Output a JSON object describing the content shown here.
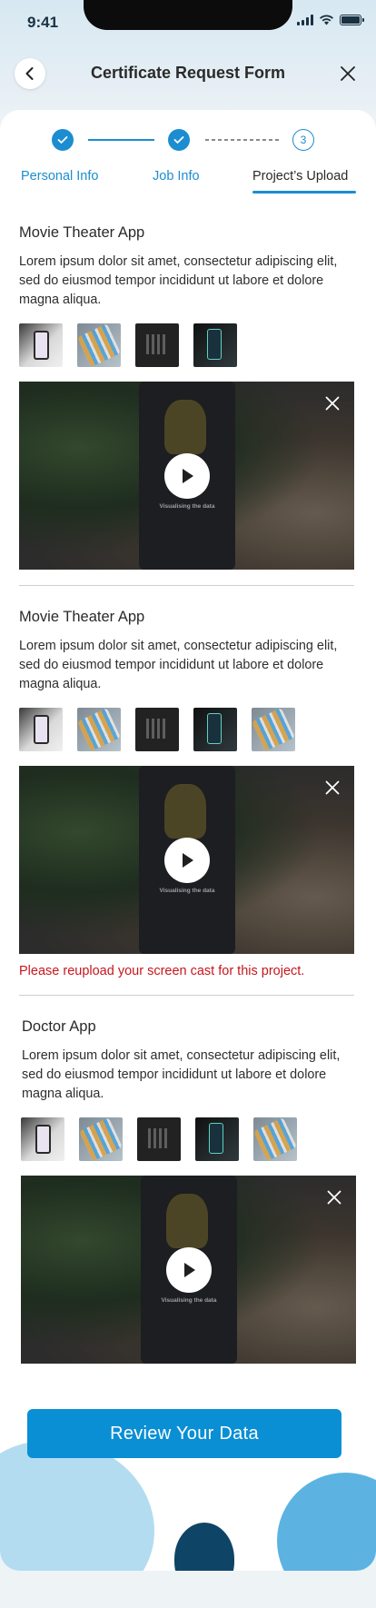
{
  "status_bar": {
    "time": "9:41"
  },
  "header": {
    "title": "Certificate Request Form",
    "back_icon": "chevron-left-icon",
    "close_icon": "close-icon"
  },
  "stepper": {
    "steps": [
      {
        "label": "Personal Info",
        "state": "done"
      },
      {
        "label": "Job Info",
        "state": "done"
      },
      {
        "label": "Project’s Upload",
        "state": "current",
        "number": "3"
      }
    ]
  },
  "projects": [
    {
      "title": "Movie Theater App",
      "description": "Lorem ipsum dolor sit amet, consectetur adipiscing elit, sed do eiusmod tempor incididunt ut labore et dolore magna aliqua.",
      "thumbnails": [
        "phone-in-hand",
        "app-grid",
        "dark-grid",
        "phone-dark"
      ],
      "video": {
        "caption": "Visualising the data",
        "play_icon": "play-icon"
      },
      "error": ""
    },
    {
      "title": "Movie Theater App",
      "description": "Lorem ipsum dolor sit amet, consectetur adipiscing elit, sed do eiusmod tempor incididunt ut labore et dolore magna aliqua.",
      "thumbnails": [
        "phone-in-hand",
        "app-grid",
        "dark-grid",
        "phone-dark",
        "app-grid"
      ],
      "video": {
        "caption": "Visualising the data",
        "play_icon": "play-icon"
      },
      "error": "Please reupload your screen cast for this project."
    },
    {
      "title": "Doctor App",
      "description": "Lorem ipsum dolor sit amet, consectetur adipiscing elit, sed do eiusmod tempor incididunt ut labore et dolore magna aliqua.",
      "thumbnails": [
        "phone-in-hand",
        "app-grid",
        "dark-grid",
        "phone-dark",
        "app-grid"
      ],
      "video": {
        "caption": "Visualising the data",
        "play_icon": "play-icon"
      },
      "error": ""
    }
  ],
  "footer": {
    "review_button": "Review Your Data"
  },
  "colors": {
    "accent": "#1b8dd0",
    "button": "#0a8fd4",
    "error": "#c7161d",
    "blob_light": "#b3dcf1",
    "blob_mid": "#5cb3e1",
    "blob_dark": "#0e4466"
  }
}
